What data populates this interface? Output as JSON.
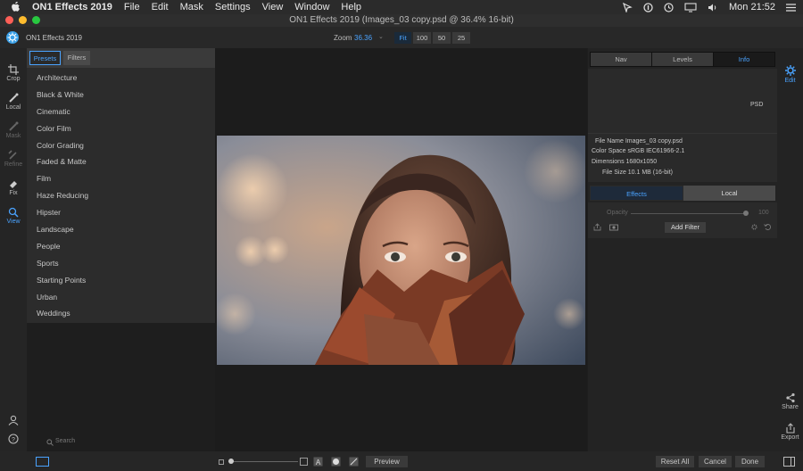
{
  "menubar": {
    "items": [
      "ON1 Effects 2019",
      "File",
      "Edit",
      "Mask",
      "Settings",
      "View",
      "Window",
      "Help"
    ],
    "clock": "Mon 21:52"
  },
  "window": {
    "title": "ON1 Effects 2019 (Images_03 copy.psd @ 36.4% 16-bit)"
  },
  "toolbar": {
    "app_name": "ON1 Effects 2019",
    "zoom_label": "Zoom",
    "zoom_value": "36.36",
    "zoom_buttons": [
      "Fit",
      "100",
      "50",
      "25"
    ]
  },
  "tools": [
    "Crop",
    "Local",
    "Mask",
    "Refine",
    "Fix",
    "View"
  ],
  "presets": {
    "tabs": [
      "Presets",
      "Filters"
    ],
    "categories": [
      "Architecture",
      "Black & White",
      "Cinematic",
      "Color Film",
      "Color Grading",
      "Faded & Matte",
      "Film",
      "Haze Reducing",
      "Hipster",
      "Landscape",
      "People",
      "Sports",
      "Starting Points",
      "Urban",
      "Weddings"
    ]
  },
  "search": {
    "placeholder": "Search"
  },
  "right_panel": {
    "tabs": [
      "Nav",
      "Levels",
      "Info"
    ],
    "info": {
      "format": "PSD",
      "file_name": "File Name Images_03 copy.psd",
      "color_space": "Color Space sRGB IEC61966-2.1",
      "dimensions": "Dimensions 1680x1050",
      "file_size": "File Size 10.1 MB (16-bit)"
    },
    "effect_tabs": [
      "Effects",
      "Local"
    ],
    "opacity_label": "Opacity",
    "opacity_value": "100",
    "add_filter": "Add Filter"
  },
  "right_rail": {
    "edit": "Edit",
    "share": "Share",
    "export": "Export"
  },
  "bottom": {
    "preview": "Preview",
    "reset_all": "Reset All",
    "cancel": "Cancel",
    "done": "Done"
  },
  "colors": {
    "accent": "#4aa3ff",
    "panel": "#2c2c2c",
    "background": "#1e1e1e"
  }
}
